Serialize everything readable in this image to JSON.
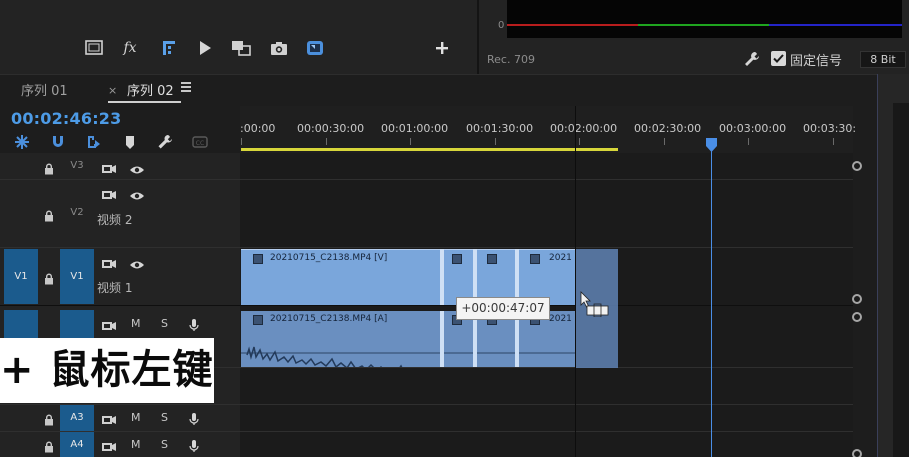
{
  "toolbar": {
    "buttons": [
      "safe-margins-icon",
      "fx-icon",
      "export-frame-settings-icon",
      "play-icon",
      "compare-view-icon",
      "camera-icon",
      "vr-icon",
      "add-icon"
    ],
    "fx_label": "fx"
  },
  "scope": {
    "zero_label": "0",
    "colors": {
      "red": "#b81d1d",
      "green": "#1fa51f",
      "blue": "#2424c8"
    }
  },
  "color_panel": {
    "rec_label": "Rec. 709",
    "fixed_signal_label": "固定信号",
    "fixed_signal_checked": true,
    "bit_depth": "8 Bit"
  },
  "sequence_tabs": [
    {
      "label": "序列 01",
      "active": false
    },
    {
      "label": "序列 02",
      "active": true
    }
  ],
  "tab_close": "×",
  "timecode": "00:02:46:23",
  "ruler": {
    "labels": [
      ":00:00",
      "00:00:30:00",
      "00:01:00:00",
      "00:01:30:00",
      "00:02:00:00",
      "00:02:30:00",
      "00:03:00:00",
      "00:03:30:"
    ]
  },
  "tracks": {
    "v3": {
      "target": "V3",
      "name": ""
    },
    "v2": {
      "target": "V2",
      "name": "视频 2"
    },
    "v1": {
      "source": "V1",
      "target": "V1",
      "name": "视频 1"
    },
    "a1": {
      "mute": "M",
      "solo": "S"
    },
    "a3": {
      "target": "A3",
      "mute": "M",
      "solo": "S"
    },
    "a4": {
      "target": "A4",
      "mute": "M",
      "solo": "S"
    }
  },
  "clips": {
    "video_main": "20210715_C2138.MP4 [V]",
    "video_tail": "2021",
    "audio_main": "20210715_C2138.MP4 [A]",
    "audio_tail": "2021"
  },
  "tooltip": "+00:00:47:07",
  "caption": "+ 鼠标左键",
  "accent": {
    "track_blue": "#1b5b8d",
    "timecode": "#4d9be6",
    "work_area": "#d7d63a",
    "clip_video": "#7aa6db",
    "clip_audio": "#6a8fc0"
  }
}
